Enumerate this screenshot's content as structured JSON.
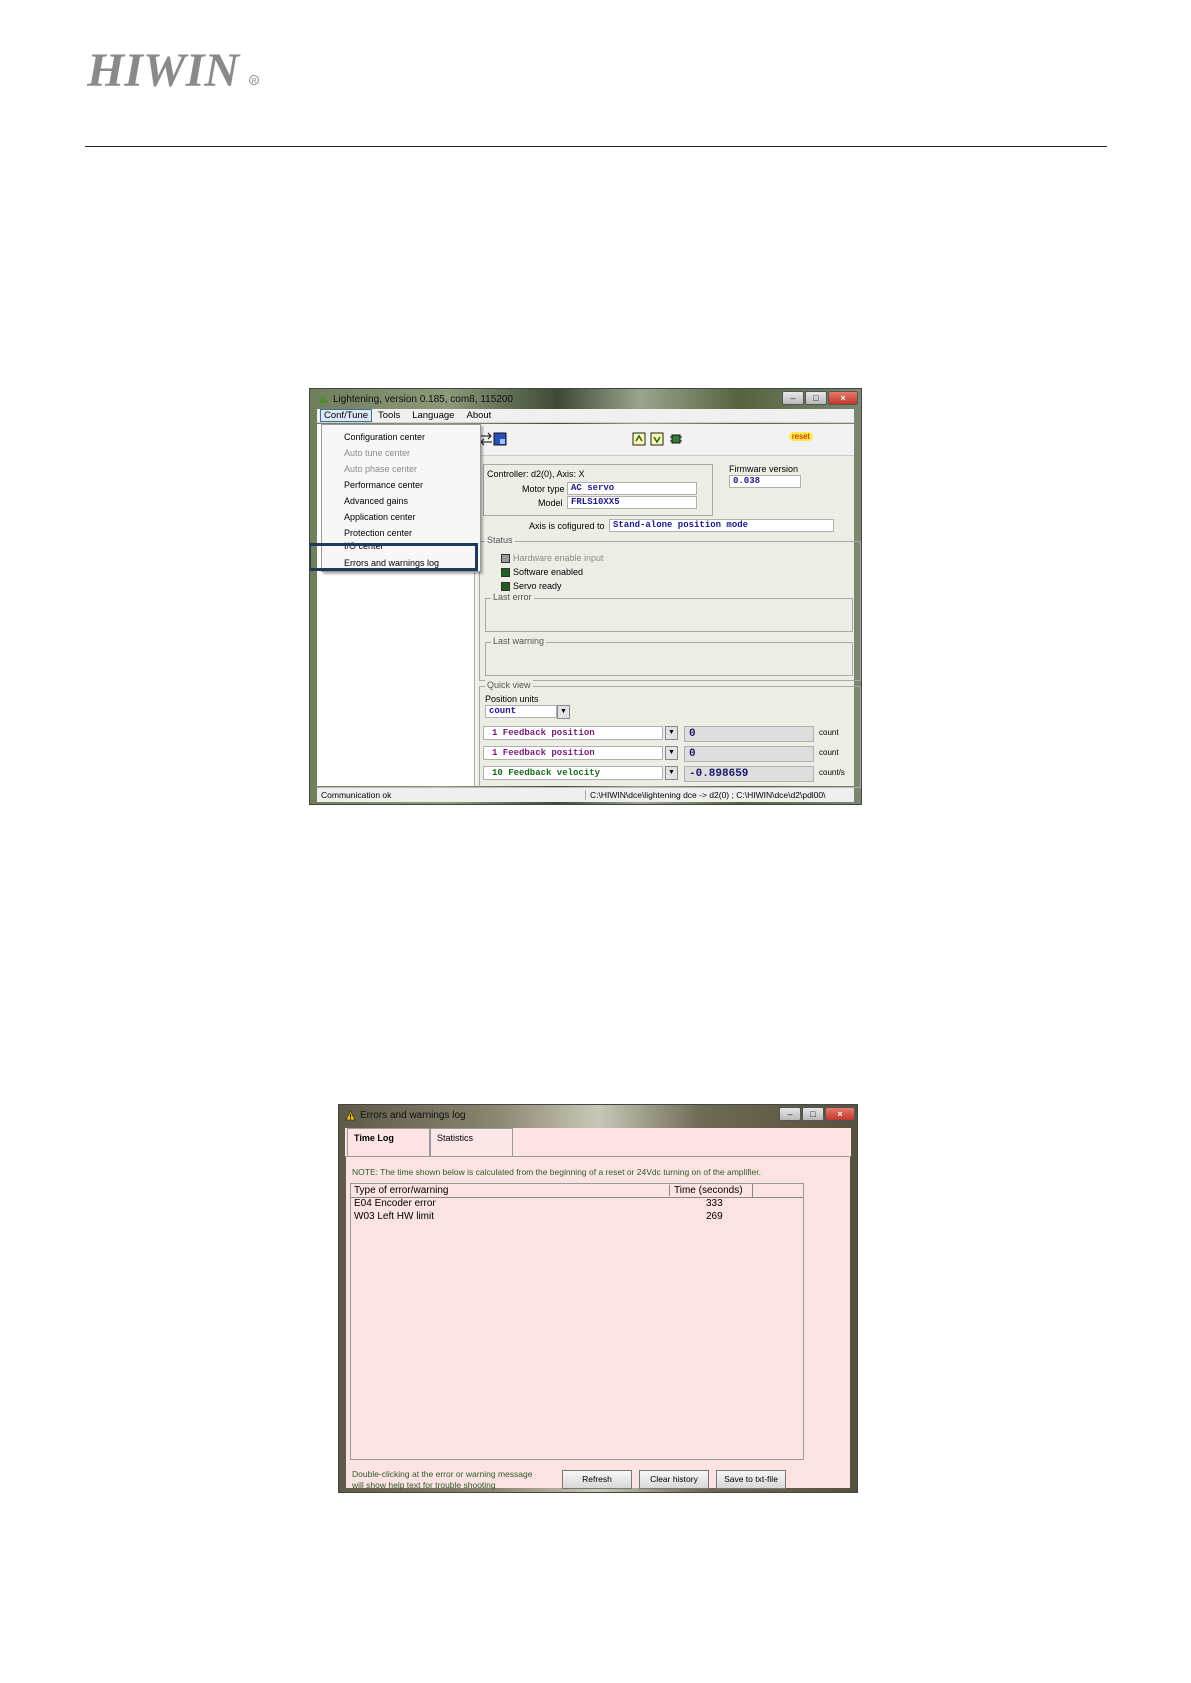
{
  "header": {
    "logo_text": "HIWIN"
  },
  "main_window": {
    "title": "Lightening, version 0.185, com8, 115200",
    "menu": [
      "Conf/Tune",
      "Tools",
      "Language",
      "About"
    ],
    "dropdown_items": [
      {
        "label": "Configuration center",
        "enabled": true
      },
      {
        "label": "Auto tune center",
        "enabled": false
      },
      {
        "label": "Auto phase center",
        "enabled": false
      },
      {
        "label": "Performance center",
        "enabled": true
      },
      {
        "label": "Advanced gains",
        "enabled": true
      },
      {
        "label": "Application center",
        "enabled": true
      },
      {
        "label": "Protection center",
        "enabled": true
      },
      {
        "label": "I/O center",
        "enabled": true
      },
      {
        "label": "Errors and warnings log",
        "enabled": true
      }
    ],
    "toolbar": {
      "reset_label": "reset"
    },
    "controller_label": "Controller: d2(0),  Axis: X",
    "motor_type_label": "Motor type",
    "motor_type_value": "AC servo",
    "model_label": "Model",
    "model_value": "FRLS10XX5",
    "firmware_label": "Firmware version",
    "firmware_value": "0.038",
    "axis_config_label": "Axis is cofigured to",
    "axis_config_value": "Stand-alone position mode",
    "status_legend": "Status",
    "status_items": [
      {
        "label": "Hardware enable input",
        "on": false
      },
      {
        "label": "Software enabled",
        "on": true
      },
      {
        "label": "Servo ready",
        "on": true
      }
    ],
    "last_error_legend": "Last error",
    "last_warning_legend": "Last warning",
    "quick_view_legend": "Quick view",
    "position_units_label": "Position units",
    "position_units_value": "count",
    "quick_view_rows": [
      {
        "name": "1  Feedback position",
        "value": "0",
        "unit": "count"
      },
      {
        "name": "1  Feedback position",
        "value": "0",
        "unit": "count"
      },
      {
        "name": "10 Feedback velocity",
        "value": "-0.898659",
        "unit": "count/s"
      }
    ],
    "statusbar_left": "Communication ok",
    "statusbar_right": "C:\\HIWIN\\dce\\lightening dce -> d2(0) ; C:\\HIWIN\\dce\\d2\\pdl00\\"
  },
  "log_window": {
    "title": "Errors and warnings log",
    "tabs": [
      "Time Log",
      "Statistics"
    ],
    "note": "NOTE: The time shown below is calculated from the beginning of a reset or 24Vdc turning on of the amplifier.",
    "columns": [
      "Type of error/warning",
      "Time (seconds)"
    ],
    "rows": [
      {
        "type": "E04 Encoder error",
        "time": "333"
      },
      {
        "type": "W03 Left HW limit",
        "time": "269"
      }
    ],
    "help_line1": "Double-clicking at the error or warning message",
    "help_line2": "will show help text for trouble shooting",
    "buttons": [
      "Refresh",
      "Clear history",
      "Save to txt-file"
    ]
  },
  "colors": {
    "highlight_border": "#1f3b5c",
    "log_panel_bg": "#fbe3e3",
    "note_text": "#2d5c26"
  }
}
